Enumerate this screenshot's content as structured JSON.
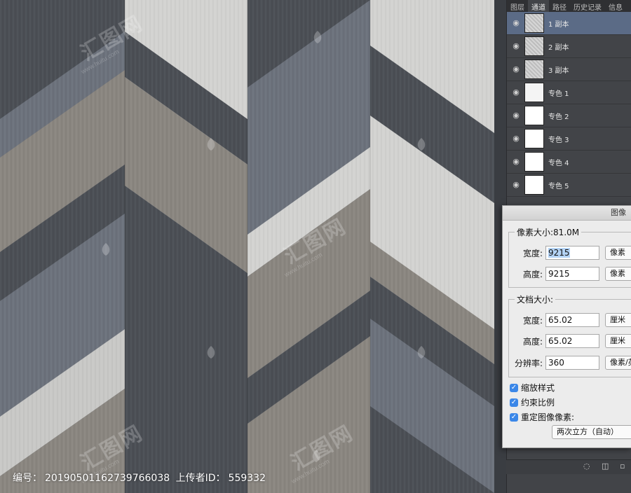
{
  "watermark": {
    "text": "汇图网",
    "url": "www.huitu.com"
  },
  "footer": {
    "id_label": "编号：",
    "id_value": "20190501162739766038",
    "uploader_label": "上传者ID：",
    "uploader_value": "559332"
  },
  "panel": {
    "tabs": [
      "图层",
      "通道",
      "路径",
      "历史记录",
      "信息"
    ],
    "active_tab": "通道",
    "channels": [
      {
        "label": "1 副本",
        "selected": true,
        "thumb": "noise"
      },
      {
        "label": "2 副本",
        "selected": false,
        "thumb": "noise"
      },
      {
        "label": "3 副本",
        "selected": false,
        "thumb": "noise"
      },
      {
        "label": "专色 1",
        "selected": false,
        "thumb": "spot1"
      },
      {
        "label": "专色 2",
        "selected": false,
        "thumb": "spot"
      },
      {
        "label": "专色 3",
        "selected": false,
        "thumb": "spot"
      },
      {
        "label": "专色 4",
        "selected": false,
        "thumb": "spot"
      },
      {
        "label": "专色 5",
        "selected": false,
        "thumb": "spot"
      }
    ]
  },
  "dialog": {
    "title": "图像",
    "pixel_group": "像素大小:81.0M",
    "width_label": "宽度:",
    "width_value": "9215",
    "width_unit": "像素",
    "height_label": "高度:",
    "height_value": "9215",
    "height_unit": "像素",
    "doc_group": "文档大小:",
    "doc_width_label": "宽度:",
    "doc_width_value": "65.02",
    "doc_width_unit": "厘米",
    "doc_height_label": "高度:",
    "doc_height_value": "65.02",
    "doc_height_unit": "厘米",
    "resolution_label": "分辨率:",
    "resolution_value": "360",
    "resolution_unit": "像素/英寸",
    "scale_styles": "缩放样式",
    "constrain": "约束比例",
    "resample": "重定图像像素:",
    "resample_method": "两次立方（自动）"
  },
  "colors": {
    "dark": "#4b4f55",
    "blue_grey": "#6c727c",
    "taupe": "#8a8680",
    "light": "#d3d3d1",
    "panel": "#424448",
    "selection": "#5b6b86",
    "checkbox": "#3b87e8"
  }
}
